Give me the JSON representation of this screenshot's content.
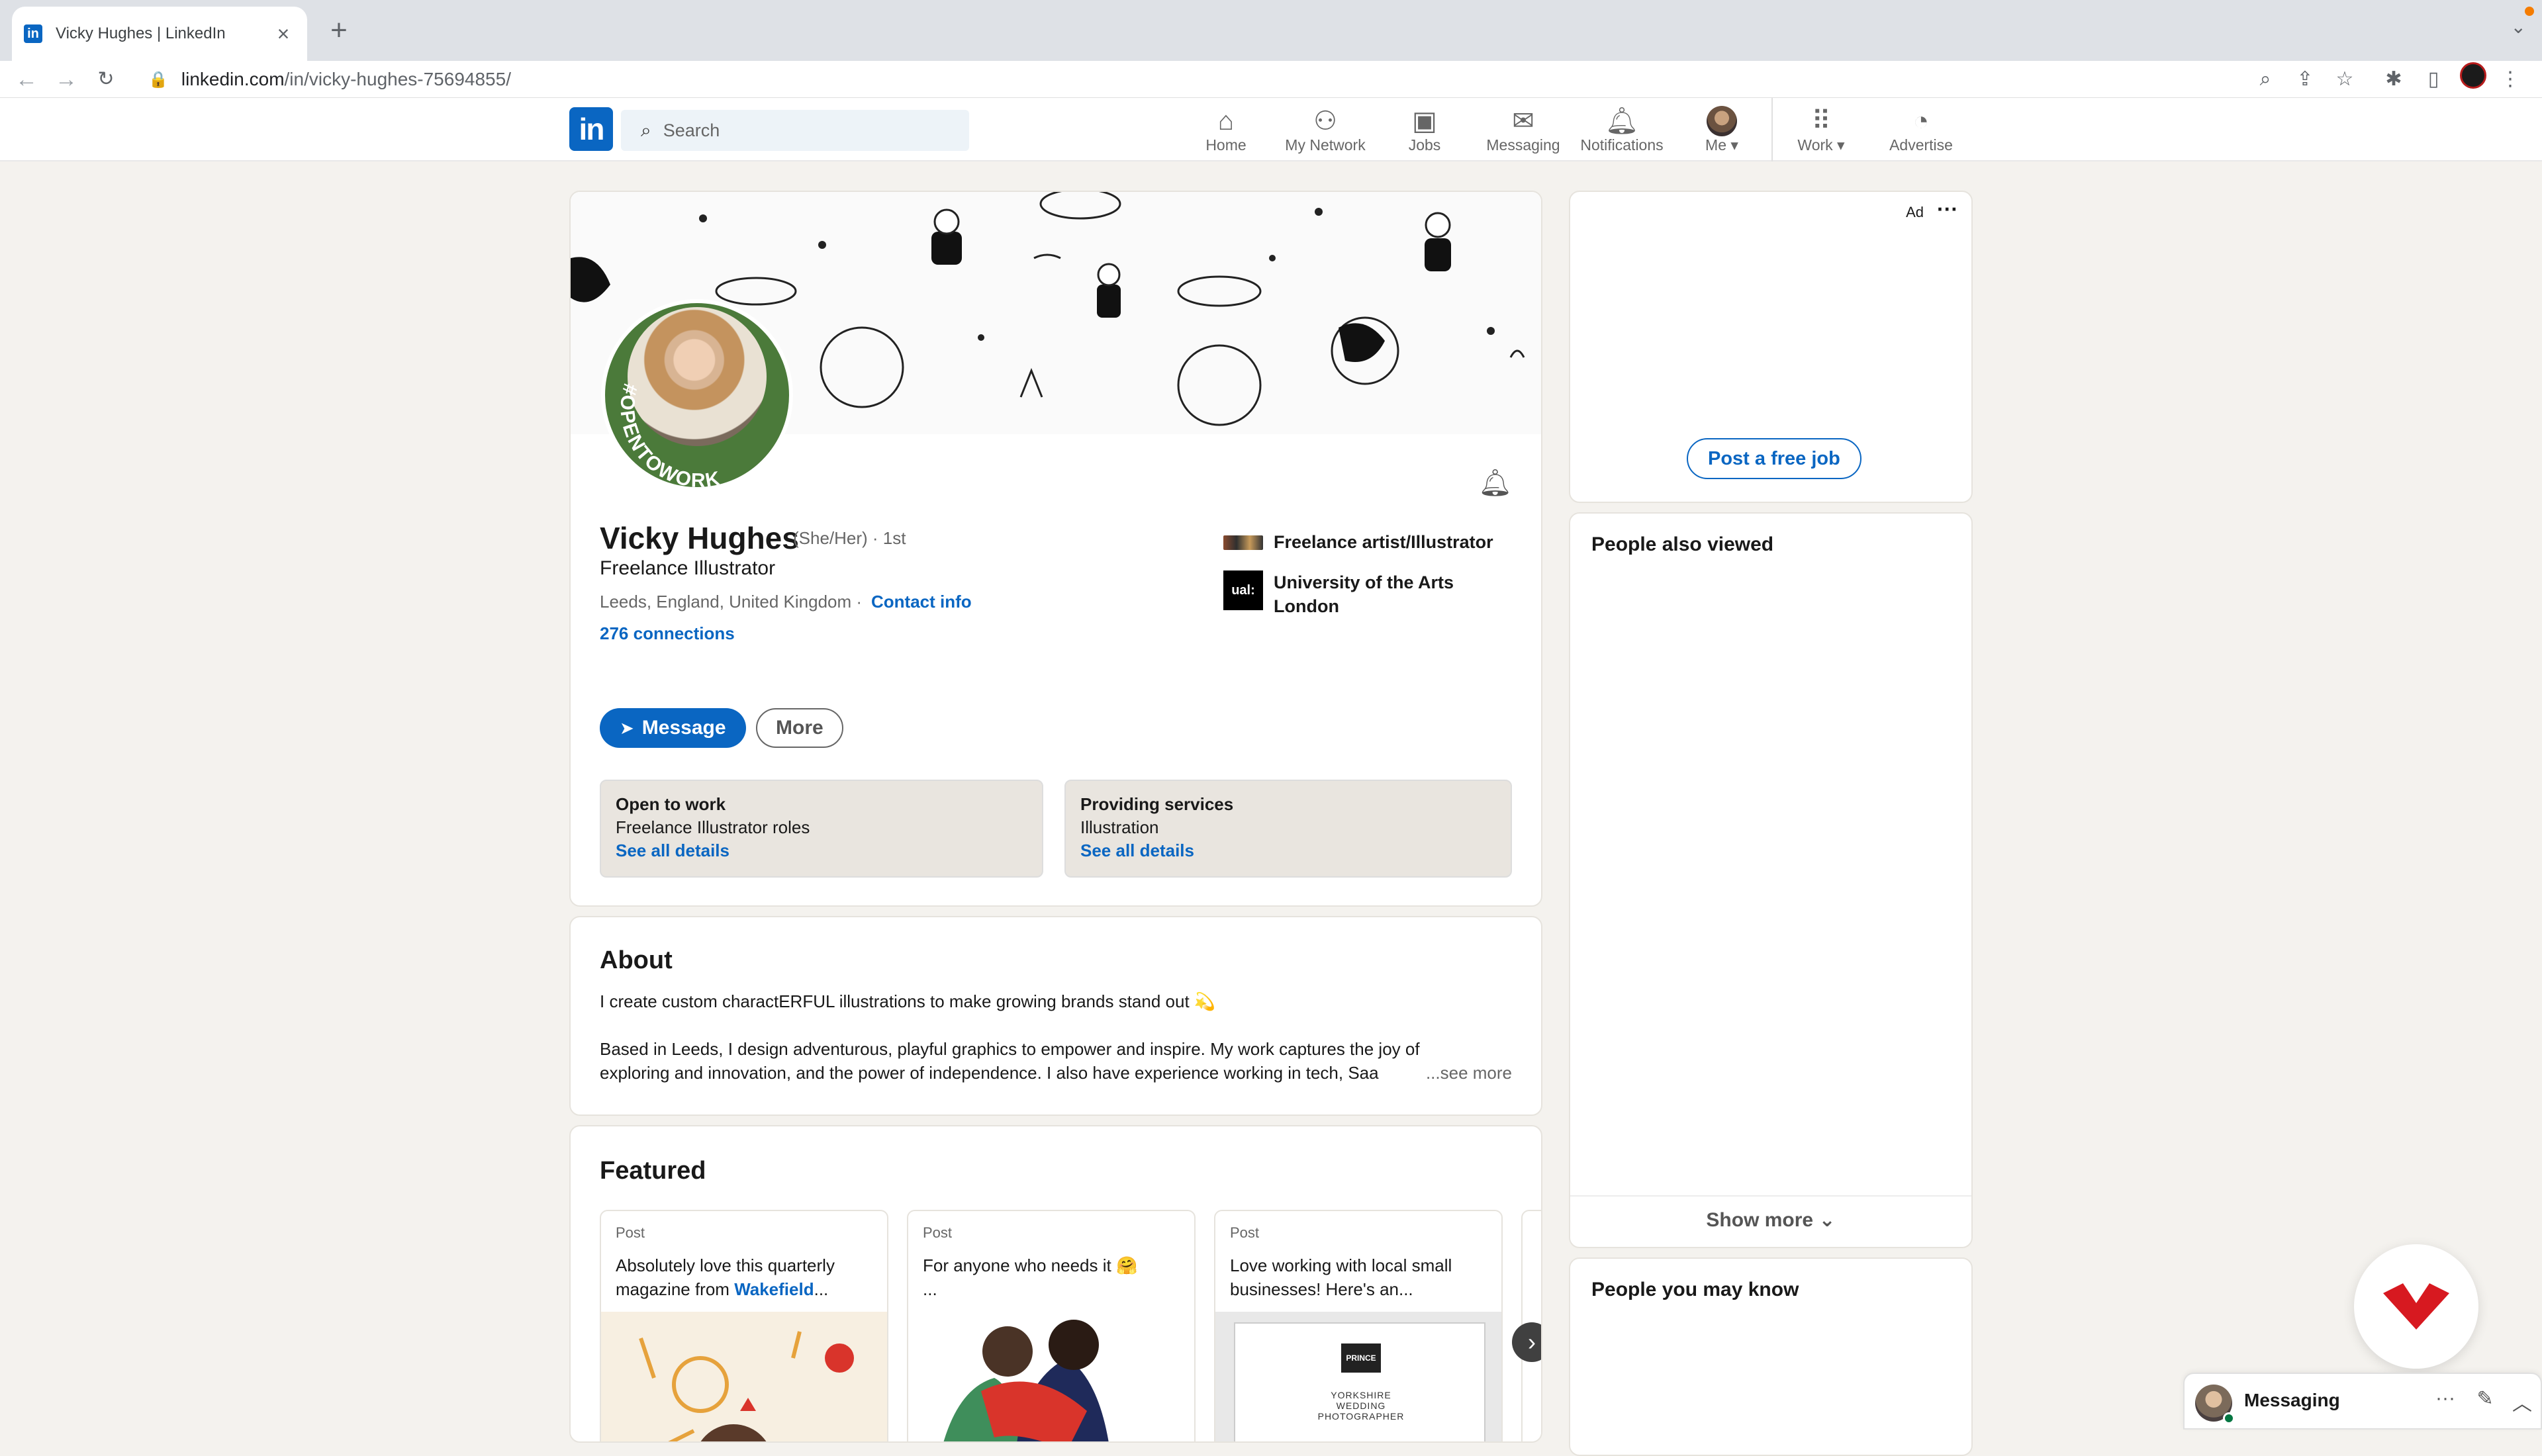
{
  "browser": {
    "tab_title": "Vicky Hughes | LinkedIn",
    "tab_favicon": "in",
    "url_host": "linkedin.com",
    "url_path": "/in/vicky-hughes-75694855/"
  },
  "nav": {
    "logo": "in",
    "search_placeholder": "Search",
    "items": [
      {
        "label": "Home",
        "icon": "home-icon"
      },
      {
        "label": "My Network",
        "icon": "network-icon"
      },
      {
        "label": "Jobs",
        "icon": "briefcase-icon"
      },
      {
        "label": "Messaging",
        "icon": "chat-icon"
      },
      {
        "label": "Notifications",
        "icon": "bell-icon"
      },
      {
        "label": "Me",
        "icon": "avatar"
      },
      {
        "label": "Work",
        "icon": "grid-icon"
      },
      {
        "label": "Advertise",
        "icon": "compass-icon"
      }
    ]
  },
  "profile": {
    "name": "Vicky Hughes",
    "pronouns": "(She/Her) · 1st",
    "headline": "Freelance Illustrator",
    "location": "Leeds, England, United Kingdom ·",
    "contact_info": "Contact info",
    "connections": "276 connections",
    "open_to_work_badge": "#OPENTOWORK",
    "experience": "Freelance artist/Illustrator",
    "education": "University of the Arts London",
    "education_logo": "ual:",
    "message_button": "Message",
    "more_button": "More",
    "open_to_work": {
      "title": "Open to work",
      "value": "Freelance Illustrator roles",
      "link": "See all details"
    },
    "providing_services": {
      "title": "Providing services",
      "value": "Illustration",
      "link": "See all details"
    }
  },
  "about": {
    "title": "About",
    "line1": "I create custom charactERFUL illustrations to make growing brands stand out 💫",
    "line2": "Based in Leeds, I design adventurous, playful graphics to empower and inspire. My work captures the joy of",
    "line3": "exploring and innovation, and the power of independence. I also have experience working in tech, Saa",
    "see_more": "...see more"
  },
  "featured": {
    "title": "Featured",
    "items": [
      {
        "type": "Post",
        "text": "Absolutely love this quarterly magazine from ",
        "link": "Wakefield",
        "suffix": "..."
      },
      {
        "type": "Post",
        "text": "For anyone who needs it 🤗",
        "link": "",
        "suffix": "..."
      },
      {
        "type": "Post",
        "text": "Love working with local small businesses! Here's an...",
        "link": "",
        "suffix": ""
      }
    ],
    "third_image_caption": "YORKSHIRE WEDDING PHOTOGRAPHER",
    "third_image_logo": "PRINCE"
  },
  "sidebar": {
    "ad_label": "Ad",
    "post_job": "Post a free job",
    "people_also_viewed": "People also viewed",
    "show_more": "Show more",
    "people_you_may_know": "People you may know"
  },
  "messaging": {
    "title": "Messaging"
  },
  "colors": {
    "accent": "#0a66c2",
    "otw_green": "#4b7a3a",
    "page_bg": "#f4f2ee"
  }
}
